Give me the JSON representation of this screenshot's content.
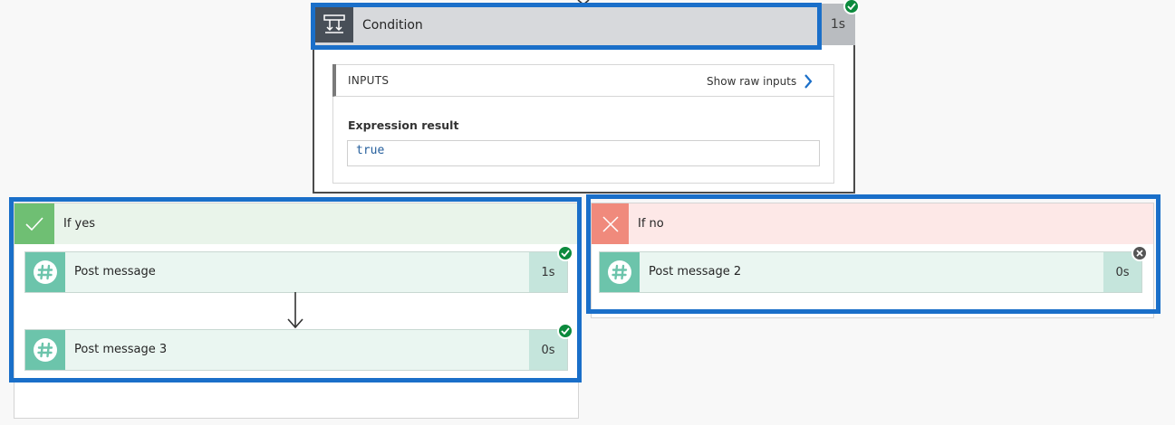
{
  "colors": {
    "highlight": "#1a6fc9",
    "success": "#0c8a3d",
    "yes_branch": "#6fbf73",
    "no_branch": "#f08a7c",
    "slack_action": "#6cc4ab"
  },
  "condition": {
    "title": "Condition",
    "duration": "1s",
    "status": "succeeded",
    "icon": "condition-icon",
    "inputs": {
      "label": "INPUTS",
      "show_raw_label": "Show raw inputs",
      "expression_label": "Expression result",
      "expression_value": "true"
    }
  },
  "branches": {
    "yes": {
      "label": "If yes",
      "icon": "check-icon",
      "actions": [
        {
          "title": "Post message",
          "duration": "1s",
          "status": "succeeded",
          "icon": "slack-hash-icon"
        },
        {
          "title": "Post message 3",
          "duration": "0s",
          "status": "succeeded",
          "icon": "slack-hash-icon"
        }
      ]
    },
    "no": {
      "label": "If no",
      "icon": "x-icon",
      "actions": [
        {
          "title": "Post message 2",
          "duration": "0s",
          "status": "skipped",
          "icon": "slack-hash-icon"
        }
      ]
    }
  }
}
